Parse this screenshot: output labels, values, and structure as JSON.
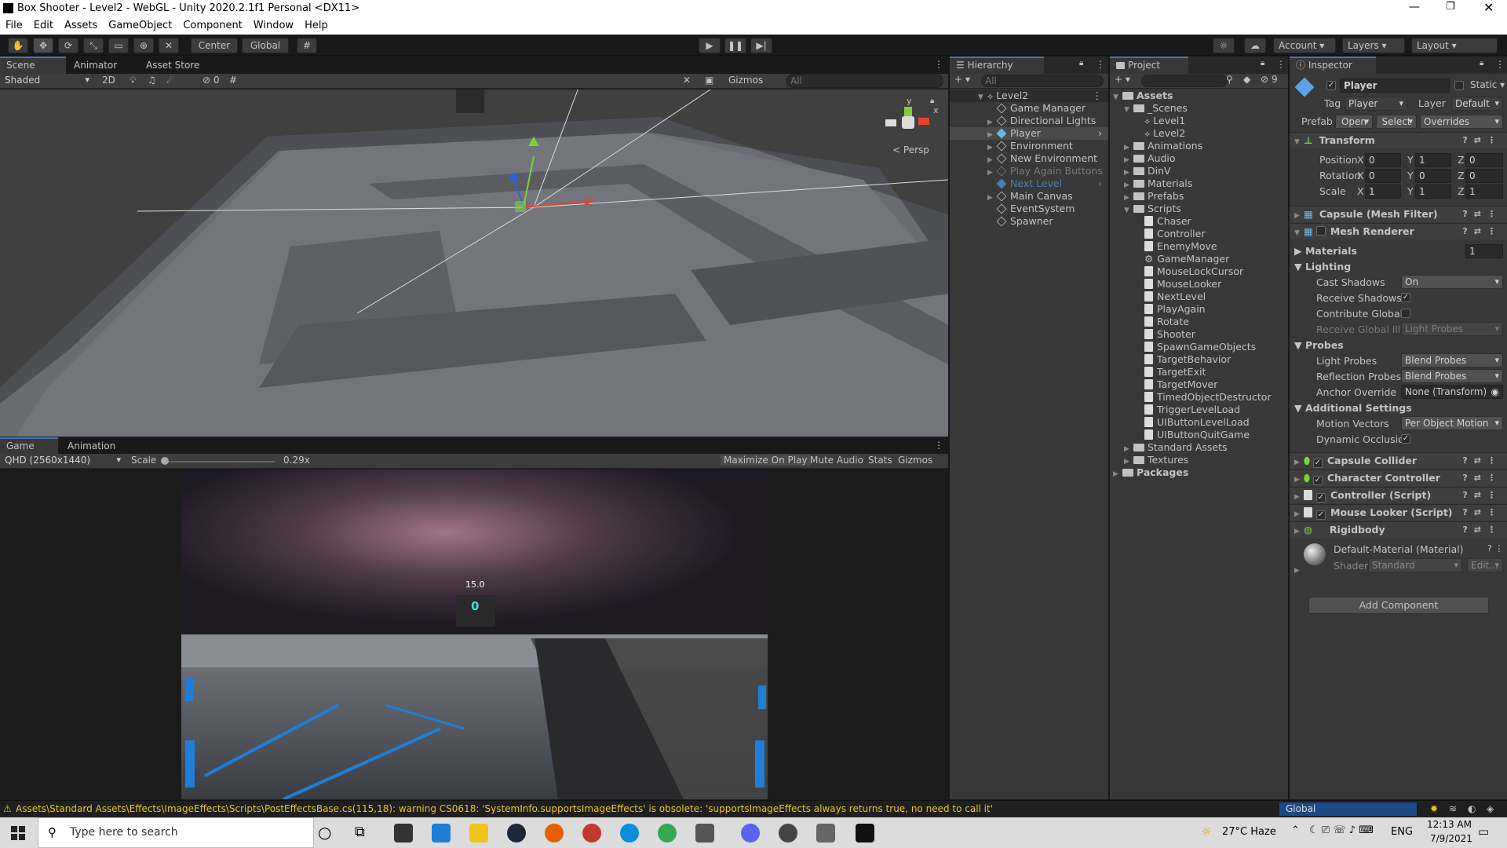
{
  "window": {
    "title": "Box Shooter - Level2 - WebGL - Unity 2020.2.1f1 Personal <DX11>"
  },
  "menu": [
    "File",
    "Edit",
    "Assets",
    "GameObject",
    "Component",
    "Window",
    "Help"
  ],
  "toolbar": {
    "center": "Center",
    "global": "Global",
    "account": "Account",
    "layers": "Layers",
    "layout": "Layout"
  },
  "scene": {
    "tabs": [
      "Scene",
      "Animator",
      "Asset Store"
    ],
    "shading": "Shaded",
    "mode2d": "2D",
    "hidden_count": "0",
    "gizmos": "Gizmos",
    "search_placeholder": "All",
    "persp": "Persp",
    "axis_y": "y",
    "axis_x": "x"
  },
  "game": {
    "tabs": [
      "Game",
      "Animation"
    ],
    "resolution": "QHD (2560x1440)",
    "scale_label": "Scale",
    "scale_value": "0.29x",
    "buttons": [
      "Maximize On Play",
      "Mute Audio",
      "Stats",
      "Gizmos"
    ],
    "hud_timer": "15.0",
    "hud_score": "0"
  },
  "hierarchy": {
    "title": "Hierarchy",
    "search_placeholder": "All",
    "scene": "Level2",
    "items": [
      "Game Manager",
      "Directional Lights",
      "Player",
      "Environment",
      "New Environment",
      "Play Again Buttons",
      "Next Level",
      "Main Canvas",
      "EventSystem",
      "Spawner"
    ]
  },
  "project": {
    "title": "Project",
    "hidden_count": "9",
    "assets": "Assets",
    "scenes_folder": "_Scenes",
    "scenes": [
      "Level1",
      "Level2"
    ],
    "folders_a": [
      "Animations",
      "Audio",
      "DinV",
      "Materials",
      "Prefabs"
    ],
    "scripts_folder": "Scripts",
    "scripts": [
      "Chaser",
      "Controller",
      "EnemyMove",
      "GameManager",
      "MouseLockCursor",
      "MouseLooker",
      "NextLevel",
      "PlayAgain",
      "Rotate",
      "Shooter",
      "SpawnGameObjects",
      "TargetBehavior",
      "TargetExit",
      "TargetMover",
      "TimedObjectDestructor",
      "TriggerLevelLoad",
      "UIButtonLevelLoad",
      "UIButtonQuitGame"
    ],
    "folders_b": [
      "Standard Assets",
      "Textures"
    ],
    "packages": "Packages"
  },
  "inspector": {
    "title": "Inspector",
    "object_name": "Player",
    "static": "Static",
    "tag_label": "Tag",
    "tag": "Player",
    "layer_label": "Layer",
    "layer": "Default",
    "prefab_label": "Prefab",
    "open": "Open",
    "select": "Select",
    "overrides": "Overrides",
    "transform": {
      "title": "Transform",
      "position": {
        "label": "Position",
        "x": "0",
        "y": "1",
        "z": "0"
      },
      "rotation": {
        "label": "Rotation",
        "x": "0",
        "y": "0",
        "z": "0"
      },
      "scale": {
        "label": "Scale",
        "x": "1",
        "y": "1",
        "z": "1"
      }
    },
    "mesh_filter": "Capsule (Mesh Filter)",
    "mesh_renderer": "Mesh Renderer",
    "materials_label": "Materials",
    "materials_count": "1",
    "lighting_label": "Lighting",
    "cast_shadows_label": "Cast Shadows",
    "cast_shadows": "On",
    "receive_shadows_label": "Receive Shadows",
    "contribute_gi_label": "Contribute Global I",
    "receive_gi_label": "Receive Global Illu",
    "receive_gi": "Light Probes",
    "probes_label": "Probes",
    "light_probes_label": "Light Probes",
    "light_probes": "Blend Probes",
    "reflection_probes_label": "Reflection Probes",
    "reflection_probes": "Blend Probes",
    "anchor_label": "Anchor Override",
    "anchor": "None (Transform)",
    "additional_label": "Additional Settings",
    "motion_label": "Motion Vectors",
    "motion": "Per Object Motion",
    "dynamic_label": "Dynamic Occlusio",
    "components": [
      "Capsule Collider",
      "Character Controller",
      "Controller (Script)",
      "Mouse Looker (Script)",
      "Rigidbody"
    ],
    "material_name": "Default-Material (Material)",
    "shader_label": "Shader",
    "shader": "Standard",
    "edit": "Edit...",
    "add_component": "Add Component"
  },
  "status": {
    "warning": "Assets\\Standard Assets\\Effects\\ImageEffects\\Scripts\\PostEffectsBase.cs(115,18): warning CS0618: 'SystemInfo.supportsImageEffects' is obsolete: 'supportsImageEffects always returns true, no need to call it'",
    "progress": "Global Illumi...Preprocessing"
  },
  "taskbar": {
    "search_placeholder": "Type here to search",
    "weather": "27°C  Haze",
    "lang": "ENG",
    "time": "12:13 AM",
    "date": "7/9/2021"
  },
  "colors": {
    "accent": "#3a79bb",
    "warning": "#f0c419",
    "panel": "#383838",
    "status_progress": "#1c4a86"
  }
}
